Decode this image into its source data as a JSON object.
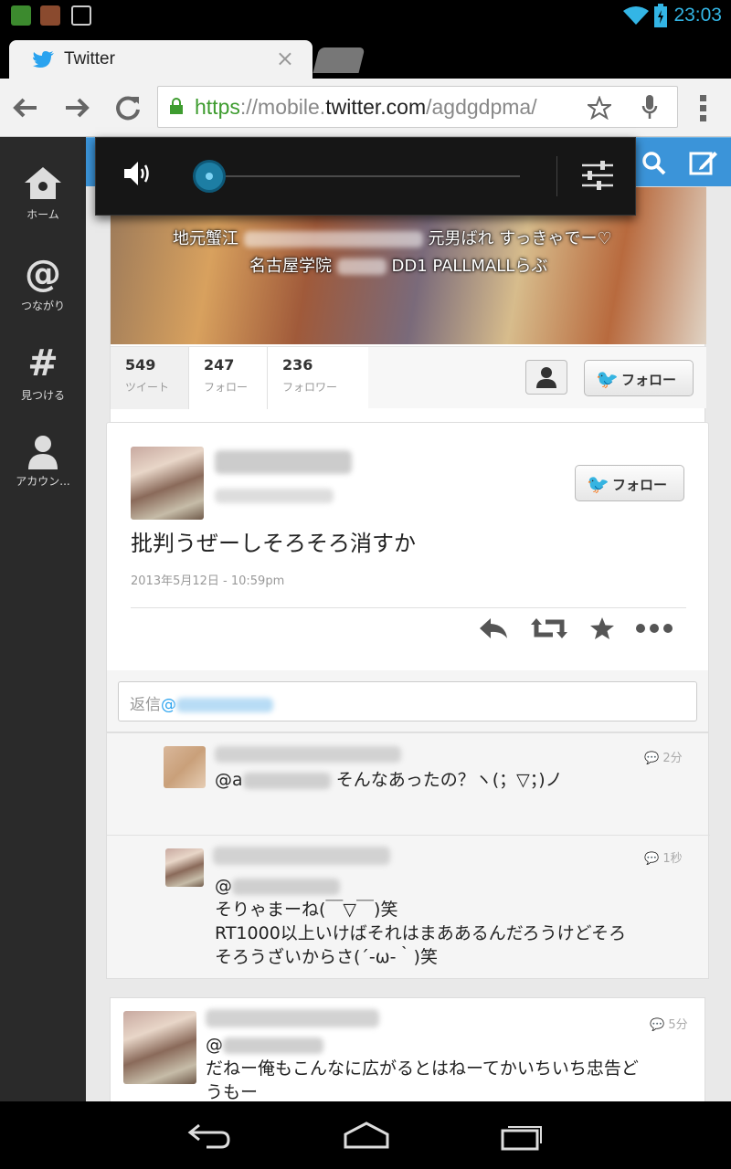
{
  "status_bar": {
    "time": "23:03",
    "icons": [
      "app-icon-green",
      "app-icon-brown",
      "image-icon",
      "wifi-icon",
      "battery-icon"
    ]
  },
  "browser": {
    "tab_title": "Twitter",
    "tab_close": "×",
    "url_scheme": "https",
    "url_sep": "://",
    "url_prefix": "mobile.",
    "url_host": "twitter.com",
    "url_path": "/agdgdpma/"
  },
  "sidebar": {
    "items": [
      {
        "icon": "home-icon",
        "label": "ホーム"
      },
      {
        "icon": "at-icon",
        "label": "つながり"
      },
      {
        "icon": "hash-icon",
        "label": "見つける"
      },
      {
        "icon": "person-icon",
        "label": "アカウン..."
      }
    ]
  },
  "volume": {
    "level": 0.0
  },
  "profile": {
    "bio_line1_start": "地元蟹江",
    "bio_line1_end": "元男ばれ すっきゃでー♡",
    "bio_line2_start": "名古屋学院",
    "bio_line2_end": "DD1 PALLMALLらぶ",
    "stats": [
      {
        "num": "549",
        "label": "ツイート"
      },
      {
        "num": "247",
        "label": "フォロー"
      },
      {
        "num": "236",
        "label": "フォロワー"
      }
    ],
    "follow_label": "フォロー"
  },
  "tweet": {
    "text": "批判うぜーしそろそろ消すか",
    "date": "2013年5月12日 - 10:59pm",
    "follow_label": "フォロー"
  },
  "reply_box": {
    "placeholder_prefix": "返信",
    "at": "@"
  },
  "replies": [
    {
      "time": "2分",
      "mention_prefix": "@a",
      "body": "そんなあったの？ヽ(；▽；)ノ"
    },
    {
      "time": "1秒",
      "mention_prefix": "@",
      "body_line1": "そりゃまーね(￣▽￣)笑",
      "body_line2": "RT1000以上いけばそれはまああるんだろうけどそろ",
      "body_line3": "そろうざいからさ(´-ω-｀)笑"
    }
  ],
  "bottom_tweet": {
    "time": "5分",
    "mention_prefix": "@",
    "body_line1": "だねー俺もこんなに広がるとはねーてかいちいち忠告ど",
    "body_line2": "うもー"
  }
}
